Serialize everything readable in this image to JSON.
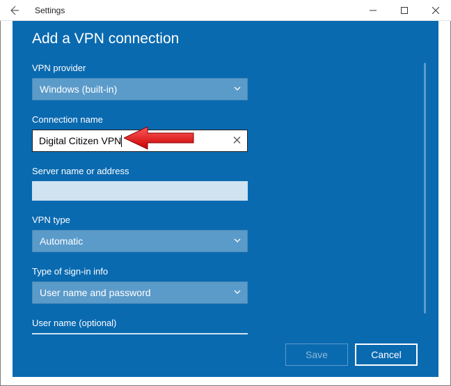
{
  "window": {
    "title": "Settings"
  },
  "modal": {
    "heading": "Add a VPN connection",
    "fields": {
      "provider": {
        "label": "VPN provider",
        "value": "Windows (built-in)"
      },
      "connection_name": {
        "label": "Connection name",
        "value": "Digital Citizen VPN"
      },
      "server": {
        "label": "Server name or address",
        "value": ""
      },
      "vpn_type": {
        "label": "VPN type",
        "value": "Automatic"
      },
      "signin": {
        "label": "Type of sign-in info",
        "value": "User name and password"
      },
      "username": {
        "label": "User name (optional)"
      }
    },
    "buttons": {
      "save": "Save",
      "cancel": "Cancel"
    }
  }
}
